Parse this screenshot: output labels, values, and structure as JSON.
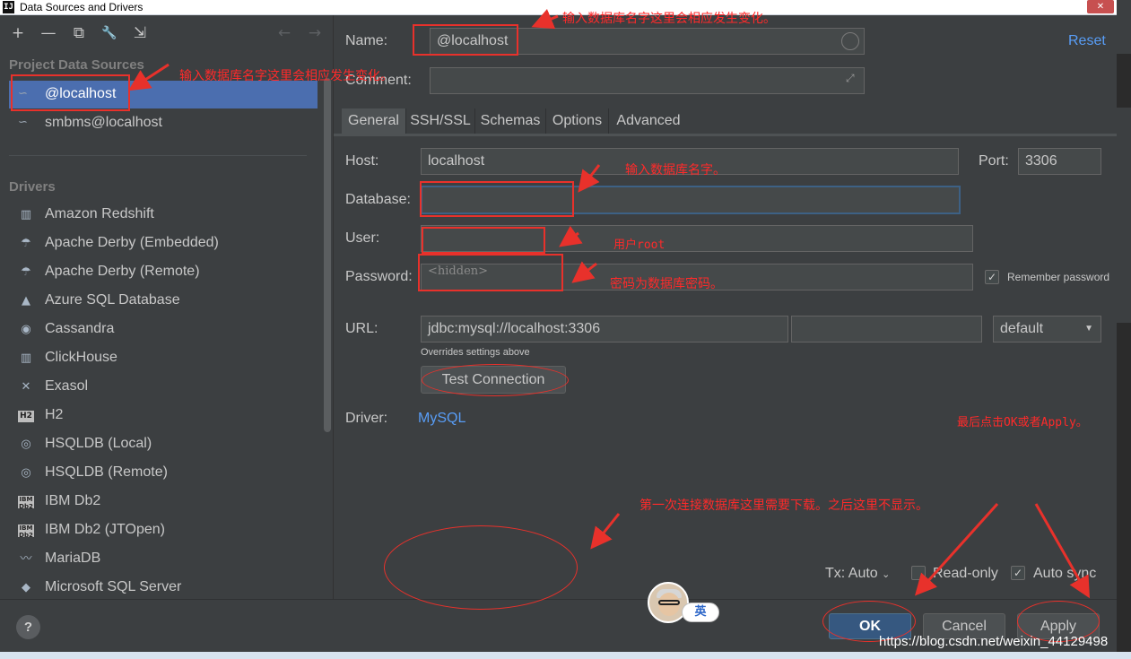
{
  "window": {
    "title": "Data Sources and Drivers",
    "app_icon_glyph": "IJ",
    "close_glyph": "✕"
  },
  "toolbar": {
    "add_glyph": "+",
    "remove_glyph": "—",
    "copy_glyph": "⧉",
    "properties_glyph": "🔧",
    "import_glyph": "⇲",
    "back_glyph": "←",
    "forward_glyph": "→"
  },
  "sidebar": {
    "project_header": "Project Data Sources",
    "project_items": [
      {
        "label": "@localhost",
        "icon": "mysql-dolphin-icon",
        "selected": true
      },
      {
        "label": "smbms@localhost",
        "icon": "mysql-dolphin-icon",
        "selected": false
      }
    ],
    "drivers_header": "Drivers",
    "drivers": [
      {
        "label": "Amazon Redshift",
        "icon": "redshift-icon",
        "glyph": "▥"
      },
      {
        "label": "Apache Derby (Embedded)",
        "icon": "derby-hat-icon",
        "glyph": "☂"
      },
      {
        "label": "Apache Derby (Remote)",
        "icon": "derby-hat-icon",
        "glyph": "☂"
      },
      {
        "label": "Azure SQL Database",
        "icon": "azure-icon",
        "glyph": "▲"
      },
      {
        "label": "Cassandra",
        "icon": "cassandra-eye-icon",
        "glyph": "◉"
      },
      {
        "label": "ClickHouse",
        "icon": "clickhouse-icon",
        "glyph": "▥"
      },
      {
        "label": "Exasol",
        "icon": "exasol-icon",
        "glyph": "✕"
      },
      {
        "label": "H2",
        "icon": "h2-icon",
        "glyph": "H2"
      },
      {
        "label": "HSQLDB (Local)",
        "icon": "hsqldb-icon",
        "glyph": "◎"
      },
      {
        "label": "HSQLDB (Remote)",
        "icon": "hsqldb-icon",
        "glyph": "◎"
      },
      {
        "label": "IBM Db2",
        "icon": "ibm-db2-icon",
        "glyph": "IBM Db2"
      },
      {
        "label": "IBM Db2 (JTOpen)",
        "icon": "ibm-db2-icon",
        "glyph": "IBM Db2"
      },
      {
        "label": "MariaDB",
        "icon": "mariadb-seal-icon",
        "glyph": "〰"
      },
      {
        "label": "Microsoft SQL Server",
        "icon": "mssql-icon",
        "glyph": "◆"
      }
    ]
  },
  "form": {
    "name_label": "Name:",
    "name_value": "@localhost",
    "comment_label": "Comment:",
    "comment_value": "",
    "reset_label": "Reset",
    "tabs": [
      {
        "label": "General",
        "active": true
      },
      {
        "label": "SSH/SSL",
        "active": false
      },
      {
        "label": "Schemas",
        "active": false
      },
      {
        "label": "Options",
        "active": false
      },
      {
        "label": "Advanced",
        "active": false
      }
    ],
    "host_label": "Host:",
    "host_value": "localhost",
    "port_label": "Port:",
    "port_value": "3306",
    "database_label": "Database:",
    "database_value": "",
    "user_label": "User:",
    "user_value": "",
    "password_label": "Password:",
    "password_placeholder": "<hidden>",
    "remember_password_label": "Remember password",
    "remember_password_checked": true,
    "url_label": "URL:",
    "url_value": "jdbc:mysql://localhost:3306",
    "url_extra_value": "",
    "url_mode": "default",
    "overrides_note": "Overrides settings above",
    "test_connection_label": "Test Connection",
    "driver_label": "Driver:",
    "driver_value": "MySQL"
  },
  "transaction": {
    "tx_label": "Tx: Auto",
    "read_only_label": "Read-only",
    "read_only_checked": false,
    "auto_sync_label": "Auto sync",
    "auto_sync_checked": true
  },
  "footer": {
    "help_glyph": "?",
    "ok_label": "OK",
    "cancel_label": "Cancel",
    "apply_label": "Apply"
  },
  "annotations": {
    "name_note": "输入数据库名字这里会相应发生变化。",
    "sidebar_note": "输入数据库名字这里会相应发生变化。",
    "database_note": "输入数据库名字。",
    "user_note": "用户root",
    "password_note": "密码为数据库密码。",
    "finish_note": "最后点击OK或者Apply。",
    "download_note": "第一次连接数据库这里需要下载。之后这里不显示。"
  },
  "overlay": {
    "ime_label": "英",
    "watermark": "https://blog.csdn.net/weixin_44129498"
  },
  "colors": {
    "accent": "#4b6eaf",
    "link": "#589df6",
    "annotation": "#e8312b",
    "background": "#3c3f41"
  }
}
